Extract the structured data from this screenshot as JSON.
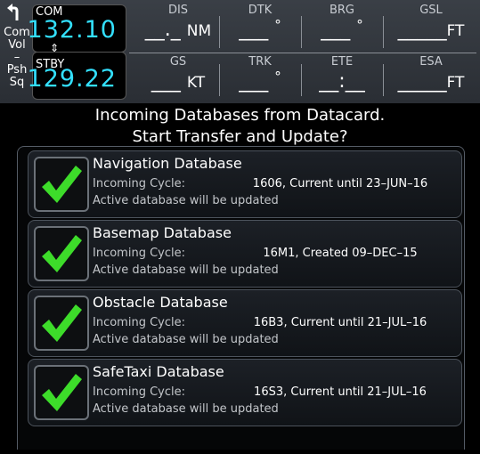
{
  "knob": {
    "lines": [
      "Com",
      "Vol",
      "–",
      "Psh",
      "Sq"
    ]
  },
  "com": {
    "active_label": "COM",
    "active_freq": "132.10",
    "standby_label": "STBY",
    "standby_freq": "129.22",
    "swap_symbol": "⇕"
  },
  "fields": [
    {
      "label": "DIS",
      "value": "__._",
      "unit": "NM"
    },
    {
      "label": "DTK",
      "value": "___",
      "unit": "°"
    },
    {
      "label": "BRG",
      "value": "___",
      "unit": "°"
    },
    {
      "label": "GSL",
      "value": "_____",
      "unit": "FT"
    },
    {
      "label": "GS",
      "value": "___",
      "unit": "KT"
    },
    {
      "label": "TRK",
      "value": "___",
      "unit": "°"
    },
    {
      "label": "ETE",
      "value": "__:__",
      "unit": ""
    },
    {
      "label": "ESA",
      "value": "_____",
      "unit": "FT"
    }
  ],
  "heading": {
    "line1": "Incoming Databases from Datacard.",
    "line2": "Start Transfer and Update?"
  },
  "databases": [
    {
      "title": "Navigation Database",
      "cycle_label": "Incoming Cycle:",
      "cycle_value": "1606, Current until 23–JUN–16",
      "note": "Active database will be updated",
      "checked": true
    },
    {
      "title": "Basemap Database",
      "cycle_label": "Incoming Cycle:",
      "cycle_value": "16M1, Created 09–DEC–15",
      "note": "Active database will be updated",
      "checked": true
    },
    {
      "title": "Obstacle Database",
      "cycle_label": "Incoming Cycle:",
      "cycle_value": "16B3, Current until 21–JUL–16",
      "note": "Active database will be updated",
      "checked": true
    },
    {
      "title": "SafeTaxi Database",
      "cycle_label": "Incoming Cycle:",
      "cycle_value": "16S3, Current until 21–JUL–16",
      "note": "Active database will be updated",
      "checked": true
    }
  ],
  "colors": {
    "freq_cyan": "#33e0ff",
    "check_green": "#3ddc2a"
  }
}
